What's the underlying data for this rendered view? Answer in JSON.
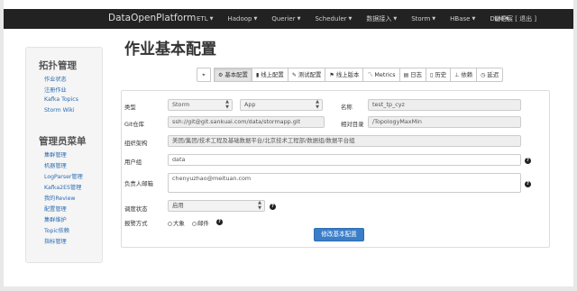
{
  "navbar": {
    "brand": "DataOpenPlatform",
    "items": [
      {
        "label": "ETL"
      },
      {
        "label": "Hadoop"
      },
      {
        "label": "Querier"
      },
      {
        "label": "Scheduler"
      },
      {
        "label": "数据接入"
      },
      {
        "label": "Storm"
      },
      {
        "label": "HBase"
      },
      {
        "label": "DLM"
      }
    ],
    "user": "谢语宸 [ 退出 ]"
  },
  "sidebar": {
    "section1": {
      "title": "拓扑管理",
      "items": [
        {
          "label": "作业状态"
        },
        {
          "label": "注册作业"
        },
        {
          "label": "Kafka Topics"
        },
        {
          "label": "Storm Wiki"
        }
      ]
    },
    "section2": {
      "title": "管理员菜单",
      "items": [
        {
          "label": "集群管理"
        },
        {
          "label": "机器管理"
        },
        {
          "label": "LogParser管理"
        },
        {
          "label": "Kafka2ES管理"
        },
        {
          "label": "我的Review"
        },
        {
          "label": "配置管理"
        },
        {
          "label": "集群维护"
        },
        {
          "label": "Topic依赖"
        },
        {
          "label": "指标管理"
        }
      ]
    }
  },
  "page": {
    "title": "作业基本配置"
  },
  "toolbar": {
    "buttons": [
      {
        "label": "",
        "icon": "crosshair-icon"
      },
      {
        "label": "基本配置",
        "icon": "gear-icon"
      },
      {
        "label": "线上配置",
        "icon": "chart-icon"
      },
      {
        "label": "测试配置",
        "icon": "wrench-icon"
      },
      {
        "label": "线上版本",
        "icon": "flag-icon"
      },
      {
        "label": "Metrics",
        "icon": "line-chart-icon"
      },
      {
        "label": "日志",
        "icon": "book-icon"
      },
      {
        "label": "历史",
        "icon": "file-icon"
      },
      {
        "label": "依赖",
        "icon": "sitemap-icon"
      },
      {
        "label": "延迟",
        "icon": "clock-icon"
      }
    ]
  },
  "form": {
    "type_label": "类型",
    "type_value": "Storm",
    "lang_value": "App",
    "name_label": "名称",
    "name_value": "test_tp_cyz",
    "git_label": "Git仓库",
    "git_value": "ssh://git@git.sankuai.com/data/stormapp.git",
    "path_label": "相对目录",
    "path_value": "/TopologyMaxMin",
    "org_label": "组织架构",
    "org_value": "美团/集团/技术工程及基础数据平台/北京技术工程部/数据组/数据平台组",
    "group_label": "用户组",
    "group_value": "data",
    "email_label": "负责人邮箱",
    "email_value": "chenyuzhao@meituan.com",
    "schedule_label": "调度状态",
    "schedule_value": "启用",
    "alarm_label": "报警方式",
    "alarm_opt1": "大象",
    "alarm_opt2": "邮件",
    "submit_label": "修改基本配置"
  },
  "colors": {
    "navbar": "#222222",
    "link": "#2a6db3",
    "primary": "#3a7ec9"
  }
}
